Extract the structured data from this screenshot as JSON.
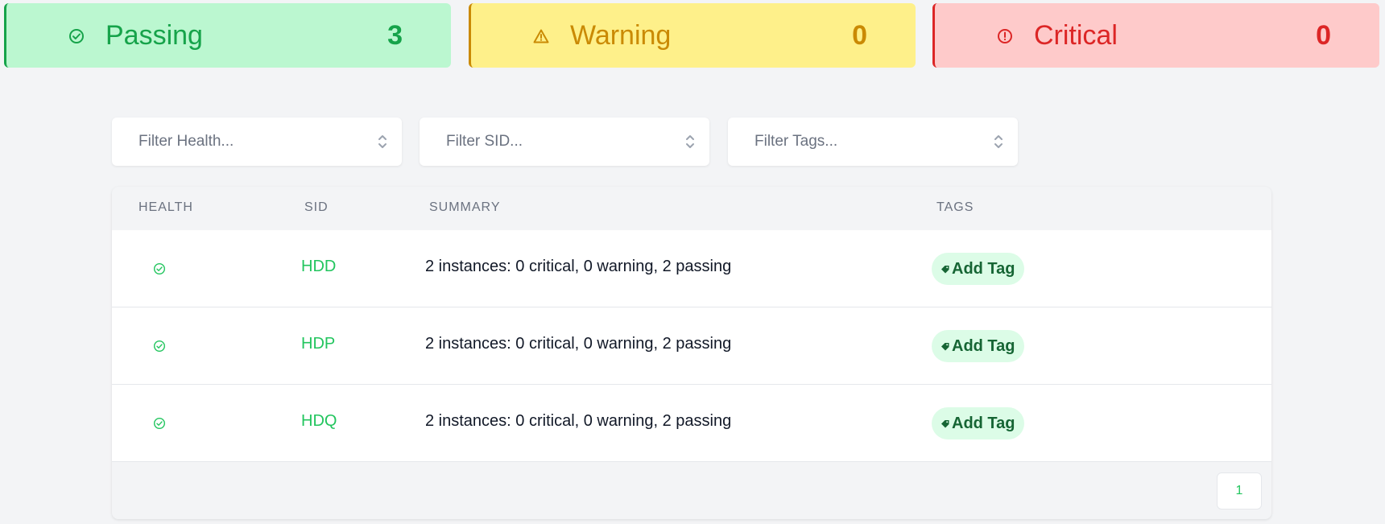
{
  "summary_cards": {
    "passing": {
      "label": "Passing",
      "count": "3",
      "color": "#16a34a",
      "icon": "check-circle-icon"
    },
    "warning": {
      "label": "Warning",
      "count": "0",
      "color": "#ca8a04",
      "icon": "warning-triangle-icon"
    },
    "critical": {
      "label": "Critical",
      "count": "0",
      "color": "#dc2626",
      "icon": "exclamation-circle-icon"
    }
  },
  "filters": {
    "health_placeholder": "Filter Health...",
    "sid_placeholder": "Filter SID...",
    "tags_placeholder": "Filter Tags..."
  },
  "table": {
    "columns": [
      "HEALTH",
      "SID",
      "SUMMARY",
      "TAGS"
    ],
    "rows": [
      {
        "health": "passing",
        "sid": "HDD",
        "summary": "2 instances: 0 critical, 0 warning, 2 passing",
        "tag_action": "Add Tag"
      },
      {
        "health": "passing",
        "sid": "HDP",
        "summary": "2 instances: 0 critical, 0 warning, 2 passing",
        "tag_action": "Add Tag"
      },
      {
        "health": "passing",
        "sid": "HDQ",
        "summary": "2 instances: 0 critical, 0 warning, 2 passing",
        "tag_action": "Add Tag"
      }
    ]
  },
  "pagination": {
    "current_page": "1"
  }
}
